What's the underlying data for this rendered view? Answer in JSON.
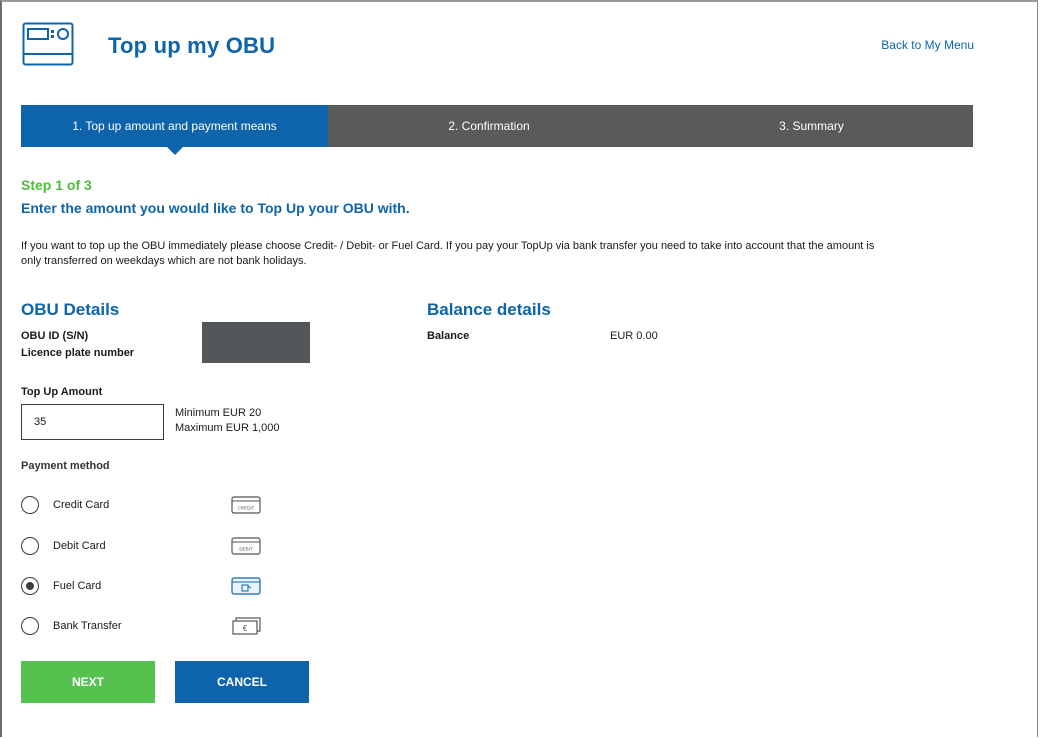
{
  "header": {
    "title": "Top up my OBU",
    "back_link": "Back to My Menu"
  },
  "stepper": {
    "steps": [
      {
        "label": "1. Top up amount and payment means",
        "active": true
      },
      {
        "label": "2. Confirmation",
        "active": false
      },
      {
        "label": "3. Summary",
        "active": false
      }
    ]
  },
  "main": {
    "step_indicator": "Step 1 of 3",
    "heading": "Enter the amount you would like to Top Up your OBU with.",
    "info_line1": "If you want to top up the OBU immediately please choose Credit- / Debit- or Fuel Card. If you pay your TopUp via bank transfer you need to take into account that the amount is",
    "info_line2": "only transferred on weekdays which are not bank holidays."
  },
  "obu_details": {
    "title": "OBU Details",
    "obu_id_label": "OBU ID (S/N)",
    "plate_label": "Licence plate number"
  },
  "balance_details": {
    "title": "Balance details",
    "balance_label": "Balance",
    "balance_value": "EUR 0.00"
  },
  "top_up": {
    "label": "Top Up Amount",
    "value": "35",
    "minimum": "Minimum EUR 20",
    "maximum": "Maximum EUR 1,000"
  },
  "payment": {
    "label": "Payment method",
    "options": [
      {
        "label": "Credit Card",
        "selected": false,
        "icon": "credit-card-icon",
        "icon_text": "CREDIT"
      },
      {
        "label": "Debit Card",
        "selected": false,
        "icon": "debit-card-icon",
        "icon_text": "DEBIT"
      },
      {
        "label": "Fuel Card",
        "selected": true,
        "icon": "fuel-card-icon",
        "icon_text": ""
      },
      {
        "label": "Bank Transfer",
        "selected": false,
        "icon": "banknote-icon",
        "icon_text": "€"
      }
    ]
  },
  "buttons": {
    "next": "NEXT",
    "cancel": "CANCEL"
  },
  "colors": {
    "brand_blue": "#0e64ab",
    "step_green": "#4dbd3a",
    "next_green": "#55c14f",
    "stepper_gray": "#5a5a5a"
  }
}
